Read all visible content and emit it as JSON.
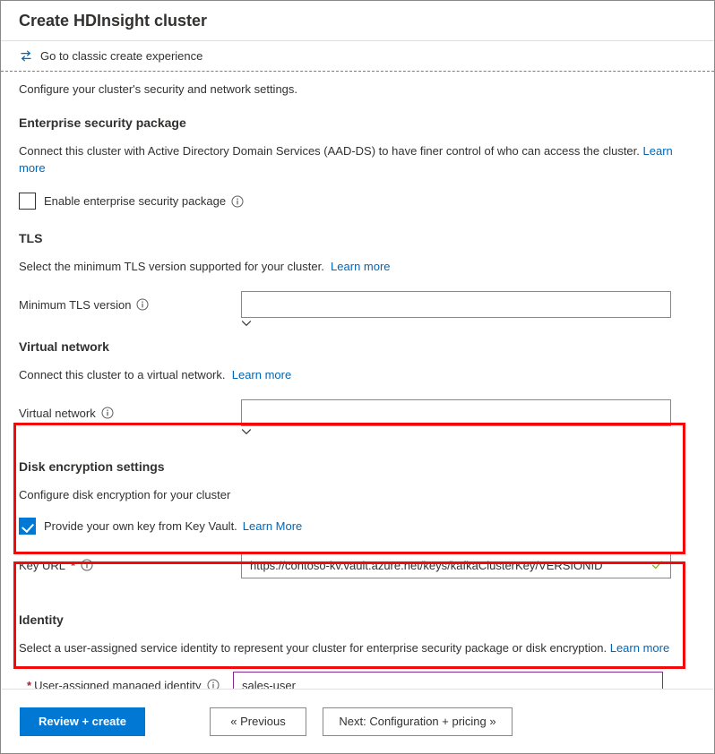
{
  "window": {
    "title": "Create HDInsight cluster"
  },
  "commandbar": {
    "classic_link": "Go to classic create experience",
    "icon": "swap-arrows-icon"
  },
  "page": {
    "lead": "Configure your cluster's security and network settings."
  },
  "sections": {
    "esp": {
      "title": "Enterprise security package",
      "description": "Connect this cluster with Active Directory Domain Services (AAD-DS) to have finer control of who can access the cluster.",
      "learn_more": "Learn more",
      "checkbox_label": "Enable enterprise security package",
      "checkbox_checked": false
    },
    "tls": {
      "title": "TLS",
      "description": "Select the minimum TLS version supported for your cluster.",
      "learn_more": "Learn more",
      "field_label": "Minimum TLS version",
      "field_value": ""
    },
    "vnet": {
      "title": "Virtual network",
      "description": "Connect this cluster to a virtual network.",
      "learn_more": "Learn more",
      "field_label": "Virtual network",
      "field_value": ""
    },
    "disk": {
      "title": "Disk encryption settings",
      "description": "Configure disk encryption for your cluster",
      "checkbox_label": "Provide your own key from Key Vault.",
      "checkbox_checked": true,
      "learn_more": "Learn More",
      "field_label": "Key URL",
      "field_required": "*",
      "field_value": "https://contoso-kv.vault.azure.net/keys/kafkaClusterKey/VERSIONID",
      "validation": "valid"
    },
    "identity": {
      "title": "Identity",
      "description": "Select a user-assigned service identity to represent your cluster for enterprise security package or disk encryption.",
      "learn_more": "Learn more",
      "field_required": "*",
      "field_label": "User-assigned managed identity",
      "field_value": "sales-user"
    }
  },
  "footer": {
    "review_create": "Review + create",
    "previous": "« Previous",
    "next": "Next: Configuration + pricing »"
  },
  "colors": {
    "accent": "#0078d4",
    "link": "#0067b8",
    "highlight": "#f20a0a",
    "required": "#a4262c",
    "valid": "#7fba00",
    "dropdown_focus": "#86288f",
    "dashed_rule": "#1a9ed9"
  }
}
